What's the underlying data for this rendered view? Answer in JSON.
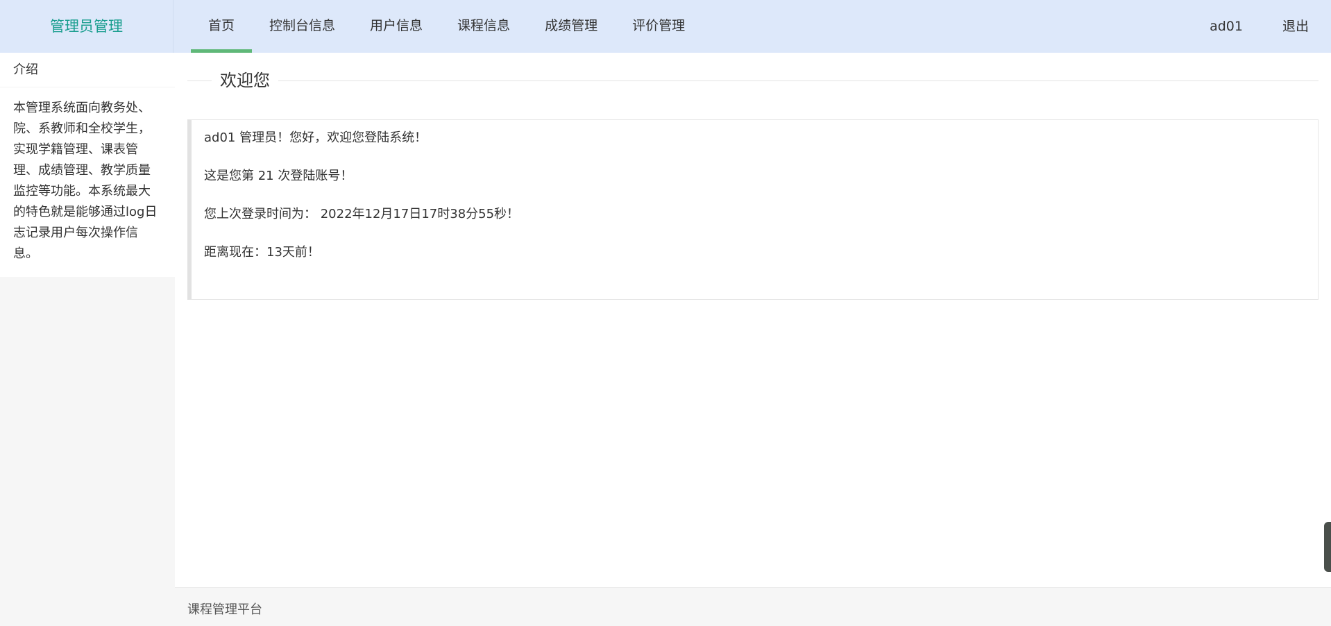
{
  "header": {
    "logo": "管理员管理",
    "nav": [
      {
        "label": "首页",
        "active": true
      },
      {
        "label": "控制台信息"
      },
      {
        "label": "用户信息"
      },
      {
        "label": "课程信息"
      },
      {
        "label": "成绩管理"
      },
      {
        "label": "评价管理"
      }
    ],
    "username": "ad01",
    "logout": "退出"
  },
  "sidebar": {
    "title": "介绍",
    "body": "本管理系统面向教务处、院、系教师和全校学生，实现学籍管理、课表管理、成绩管理、教学质量监控等功能。本系统最大的特色就是能够通过log日志记录用户每次操作信息。"
  },
  "main": {
    "legend": "欢迎您",
    "lines": [
      "ad01 管理员！您好，欢迎您登陆系统！",
      "这是您第 21 次登陆账号！",
      "您上次登录时间为： 2022年12月17日17时38分55秒！",
      "距离现在：13天前！"
    ]
  },
  "footer": {
    "text": "课程管理平台"
  }
}
